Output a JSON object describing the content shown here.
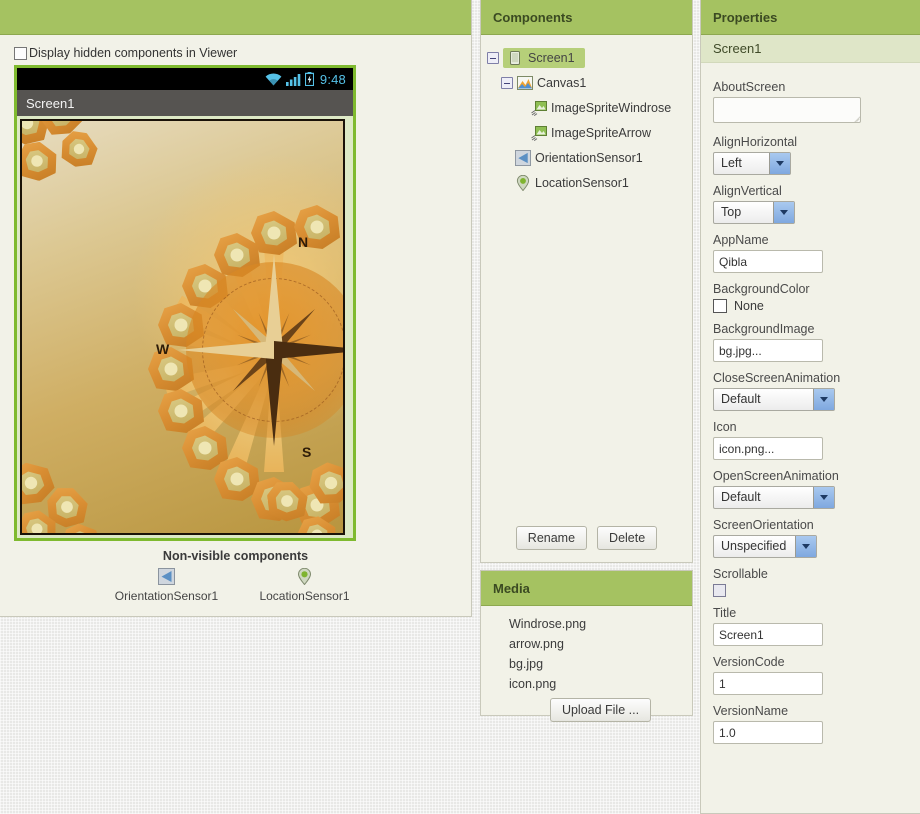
{
  "viewer": {
    "header_title": "",
    "hidden_components_label": "Display hidden components in Viewer",
    "phone": {
      "clock": "9:48",
      "title": "Screen1",
      "status_icons": [
        "wifi-icon",
        "signal-icon",
        "battery-charging-icon"
      ]
    },
    "canvas_art": {
      "direction_labels": [
        "N",
        "W",
        "S"
      ]
    },
    "nonvisible_title": "Non-visible components",
    "nonvisible_items": [
      {
        "label": "OrientationSensor1",
        "icon": "orientation-sensor-icon"
      },
      {
        "label": "LocationSensor1",
        "icon": "location-sensor-icon"
      }
    ]
  },
  "components": {
    "header_title": "Components",
    "tree": [
      {
        "label": "Screen1",
        "icon": "screen-icon",
        "depth": 0,
        "expandable": true,
        "selected": true
      },
      {
        "label": "Canvas1",
        "icon": "canvas-icon",
        "depth": 1,
        "expandable": true,
        "selected": false
      },
      {
        "label": "ImageSpriteWindrose",
        "icon": "image-sprite-icon",
        "depth": 2,
        "expandable": false,
        "selected": false
      },
      {
        "label": "ImageSpriteArrow",
        "icon": "image-sprite-icon",
        "depth": 2,
        "expandable": false,
        "selected": false
      },
      {
        "label": "OrientationSensor1",
        "icon": "orientation-sensor-icon",
        "depth": 2,
        "expandable": false,
        "selected": false
      },
      {
        "label": "LocationSensor1",
        "icon": "location-sensor-icon",
        "depth": 2,
        "expandable": false,
        "selected": false
      }
    ],
    "rename_label": "Rename",
    "delete_label": "Delete"
  },
  "media": {
    "header_title": "Media",
    "files": [
      "Windrose.png",
      "arrow.png",
      "bg.jpg",
      "icon.png"
    ],
    "upload_label": "Upload File ..."
  },
  "properties": {
    "header_title": "Properties",
    "subject": "Screen1",
    "items": [
      {
        "name": "AboutScreen",
        "type": "textarea",
        "value": ""
      },
      {
        "name": "AlignHorizontal",
        "type": "select",
        "value": "Left"
      },
      {
        "name": "AlignVertical",
        "type": "select",
        "value": "Top"
      },
      {
        "name": "AppName",
        "type": "text",
        "value": "Qibla"
      },
      {
        "name": "BackgroundColor",
        "type": "color",
        "value": "None",
        "swatch": "#ffffff"
      },
      {
        "name": "BackgroundImage",
        "type": "text",
        "value": "bg.jpg..."
      },
      {
        "name": "CloseScreenAnimation",
        "type": "select",
        "value": "Default"
      },
      {
        "name": "Icon",
        "type": "text",
        "value": "icon.png..."
      },
      {
        "name": "OpenScreenAnimation",
        "type": "select",
        "value": "Default"
      },
      {
        "name": "ScreenOrientation",
        "type": "select",
        "value": "Unspecified"
      },
      {
        "name": "Scrollable",
        "type": "checkbox",
        "value": ""
      },
      {
        "name": "Title",
        "type": "text",
        "value": "Screen1"
      },
      {
        "name": "VersionCode",
        "type": "text",
        "value": "1"
      },
      {
        "name": "VersionName",
        "type": "text",
        "value": "1.0"
      }
    ]
  },
  "colors": {
    "panel_header_green": "#a5c261",
    "panel_bg": "#f2f2e8",
    "selection_green": "#b6cf79",
    "phone_frame_green": "#7fba2f",
    "status_cyan": "#56c2e8"
  }
}
